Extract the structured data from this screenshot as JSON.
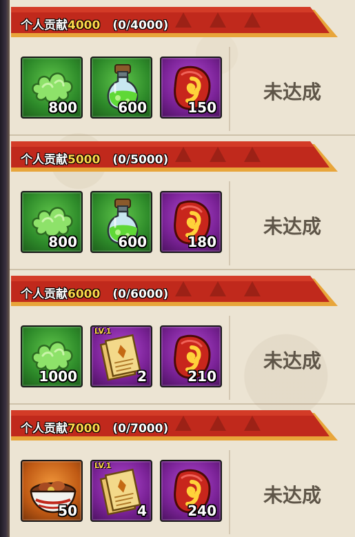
{
  "tiers": [
    {
      "label": "个人贡献",
      "amount": "4000",
      "progress": "(0/4000)",
      "status": "未达成",
      "rewards": [
        {
          "icon": "green-cloud-icon",
          "quantity": "800",
          "rarity": "green"
        },
        {
          "icon": "green-potion-icon",
          "quantity": "600",
          "rarity": "green"
        },
        {
          "icon": "red-stone-icon",
          "quantity": "150",
          "rarity": "purple"
        }
      ]
    },
    {
      "label": "个人贡献",
      "amount": "5000",
      "progress": "(0/5000)",
      "status": "未达成",
      "rewards": [
        {
          "icon": "green-cloud-icon",
          "quantity": "800",
          "rarity": "green"
        },
        {
          "icon": "green-potion-icon",
          "quantity": "600",
          "rarity": "green"
        },
        {
          "icon": "red-stone-icon",
          "quantity": "180",
          "rarity": "purple"
        }
      ]
    },
    {
      "label": "个人贡献",
      "amount": "6000",
      "progress": "(0/6000)",
      "status": "未达成",
      "rewards": [
        {
          "icon": "green-cloud-icon",
          "quantity": "1000",
          "rarity": "green"
        },
        {
          "icon": "scroll-icon",
          "quantity": "2",
          "rarity": "purple",
          "level": "LV.1"
        },
        {
          "icon": "red-stone-icon",
          "quantity": "210",
          "rarity": "purple"
        }
      ]
    },
    {
      "label": "个人贡献",
      "amount": "7000",
      "progress": "(0/7000)",
      "status": "未达成",
      "rewards": [
        {
          "icon": "food-bowl-icon",
          "quantity": "50",
          "rarity": "orange"
        },
        {
          "icon": "scroll-icon",
          "quantity": "4",
          "rarity": "purple",
          "level": "LV.1"
        },
        {
          "icon": "red-stone-icon",
          "quantity": "240",
          "rarity": "purple"
        }
      ]
    }
  ],
  "colors": {
    "banner_red": "#c0291c",
    "banner_gold": "#e8a53a",
    "amount_yellow": "#ffd84a",
    "status_gray": "#5e5548",
    "panel_bg": "#ece4d3"
  }
}
